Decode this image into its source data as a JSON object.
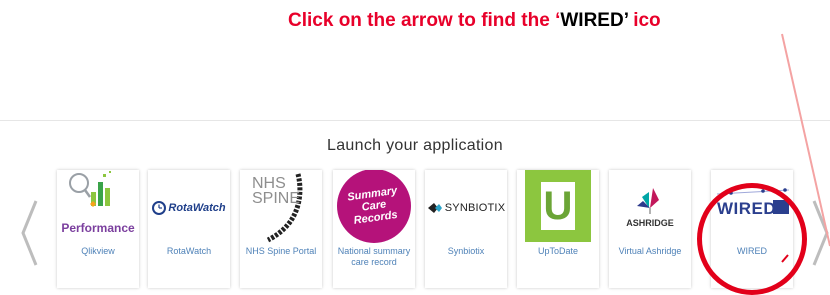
{
  "instruction": {
    "prefix": "Click on the arrow to find the ",
    "open_quote": "‘",
    "highlight": "WIRED",
    "close_quote": "’",
    "suffix": " ico"
  },
  "launcher": {
    "title": "Launch your application",
    "prev_icon": "chevron-left-icon",
    "next_icon": "chevron-right-icon",
    "apps": [
      {
        "label": "Qlikview",
        "logo_text": "Performance"
      },
      {
        "label": "RotaWatch",
        "logo_text": "RotaWatch"
      },
      {
        "label": "NHS Spine Portal",
        "logo_text": "NHS SPINE"
      },
      {
        "label": "National summary care record",
        "logo_text": "Summary Care Records"
      },
      {
        "label": "Synbiotix",
        "logo_text": "SYNBIOTIX"
      },
      {
        "label": "UpToDate",
        "logo_text": "U"
      },
      {
        "label": "Virtual Ashridge",
        "logo_text": "ASHRIDGE"
      },
      {
        "label": "WIRED",
        "logo_text": "WIRED"
      }
    ]
  },
  "colors": {
    "instruction_red": "#e8002a",
    "label_blue": "#4f82b8",
    "highlight_circle": "#e2001a",
    "uptodate_green": "#8cc63f",
    "summary_magenta": "#b5127a",
    "performance_purple": "#7b3f9e",
    "wired_navy": "#2b3f8e"
  }
}
